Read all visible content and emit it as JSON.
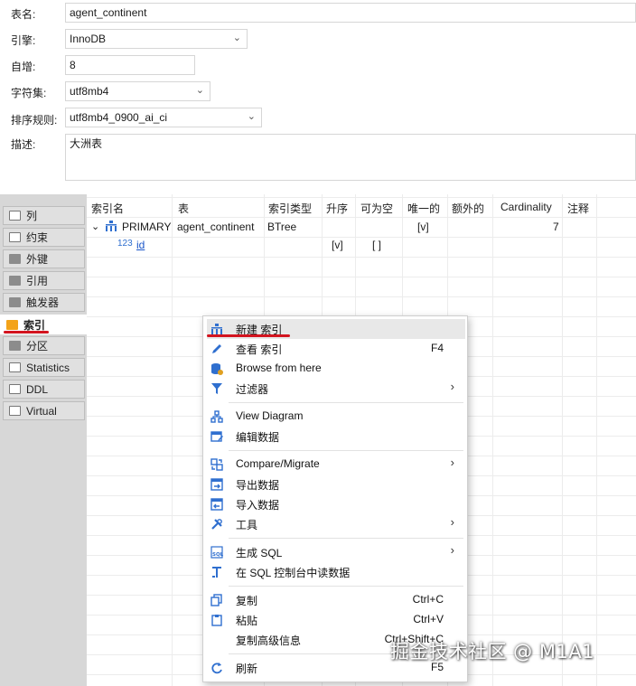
{
  "form": {
    "table_name_label": "表名:",
    "table_name_value": "agent_continent",
    "engine_label": "引擎:",
    "engine_value": "InnoDB",
    "auto_inc_label": "自增:",
    "auto_inc_value": "8",
    "charset_label": "字符集:",
    "charset_value": "utf8mb4",
    "collation_label": "排序规则:",
    "collation_value": "utf8mb4_0900_ai_ci",
    "description_label": "描述:",
    "description_value": "大洲表"
  },
  "side_tabs": [
    {
      "label": "列",
      "icon": "columns-icon"
    },
    {
      "label": "约束",
      "icon": "constraint-icon"
    },
    {
      "label": "外键",
      "icon": "folder-icon"
    },
    {
      "label": "引用",
      "icon": "folder-icon"
    },
    {
      "label": "触发器",
      "icon": "folder-icon"
    },
    {
      "label": "索引",
      "icon": "folder-icon",
      "active": true
    },
    {
      "label": "分区",
      "icon": "folder-icon"
    },
    {
      "label": "Statistics",
      "icon": "info-icon"
    },
    {
      "label": "DDL",
      "icon": "ddl-icon"
    },
    {
      "label": "Virtual",
      "icon": "virtual-icon"
    }
  ],
  "grid": {
    "headers": [
      "索引名",
      "表",
      "索引类型",
      "升序",
      "可为空",
      "唯一的",
      "额外的",
      "Cardinality",
      "注释"
    ],
    "rows": [
      {
        "expander": "v",
        "name": "PRIMARY",
        "table": "agent_continent",
        "type": "BTree",
        "unique": "[v]",
        "cardinality": "7"
      },
      {
        "name": "id",
        "ascending": "[v]",
        "nullable": "[ ]"
      }
    ]
  },
  "context_menu": {
    "items": [
      {
        "label": "新建 索引",
        "shortcut": "",
        "submenu": false,
        "icon": "new-index-icon"
      },
      {
        "label": "查看 索引",
        "shortcut": "F4",
        "submenu": false,
        "icon": "edit-pencil-icon"
      },
      {
        "label": "Browse from here",
        "shortcut": "",
        "submenu": false,
        "icon": "database-icon"
      },
      {
        "label": "过滤器",
        "shortcut": "",
        "submenu": true,
        "icon": "filter-icon"
      },
      {
        "label": "View Diagram",
        "shortcut": "",
        "submenu": false,
        "icon": "diagram-icon"
      },
      {
        "label": "编辑数据",
        "shortcut": "",
        "submenu": false,
        "icon": "edit-data-icon"
      },
      {
        "label": "Compare/Migrate",
        "shortcut": "",
        "submenu": true,
        "icon": "compare-icon"
      },
      {
        "label": "导出数据",
        "shortcut": "",
        "submenu": false,
        "icon": "export-icon"
      },
      {
        "label": "导入数据",
        "shortcut": "",
        "submenu": false,
        "icon": "import-icon"
      },
      {
        "label": "工具",
        "shortcut": "",
        "submenu": true,
        "icon": "tools-icon"
      },
      {
        "label": "生成 SQL",
        "shortcut": "",
        "submenu": true,
        "icon": "sql-icon"
      },
      {
        "label": "在 SQL 控制台中读数据",
        "shortcut": "",
        "submenu": false,
        "icon": "console-icon"
      },
      {
        "label": "复制",
        "shortcut": "Ctrl+C",
        "submenu": false,
        "icon": "copy-icon"
      },
      {
        "label": "粘贴",
        "shortcut": "Ctrl+V",
        "submenu": false,
        "icon": "paste-icon"
      },
      {
        "label": "复制高级信息",
        "shortcut": "Ctrl+Shift+C",
        "submenu": false,
        "icon": ""
      },
      {
        "label": "刷新",
        "shortcut": "F5",
        "submenu": false,
        "icon": "refresh-icon"
      }
    ]
  },
  "watermark": "掘金技术社区 @ M1A1",
  "colors": {
    "active_tab_folder": "#f3a31a",
    "active_underline": "#d3141f",
    "link": "#1a56c9",
    "icon_blue": "#2f6fcf"
  }
}
